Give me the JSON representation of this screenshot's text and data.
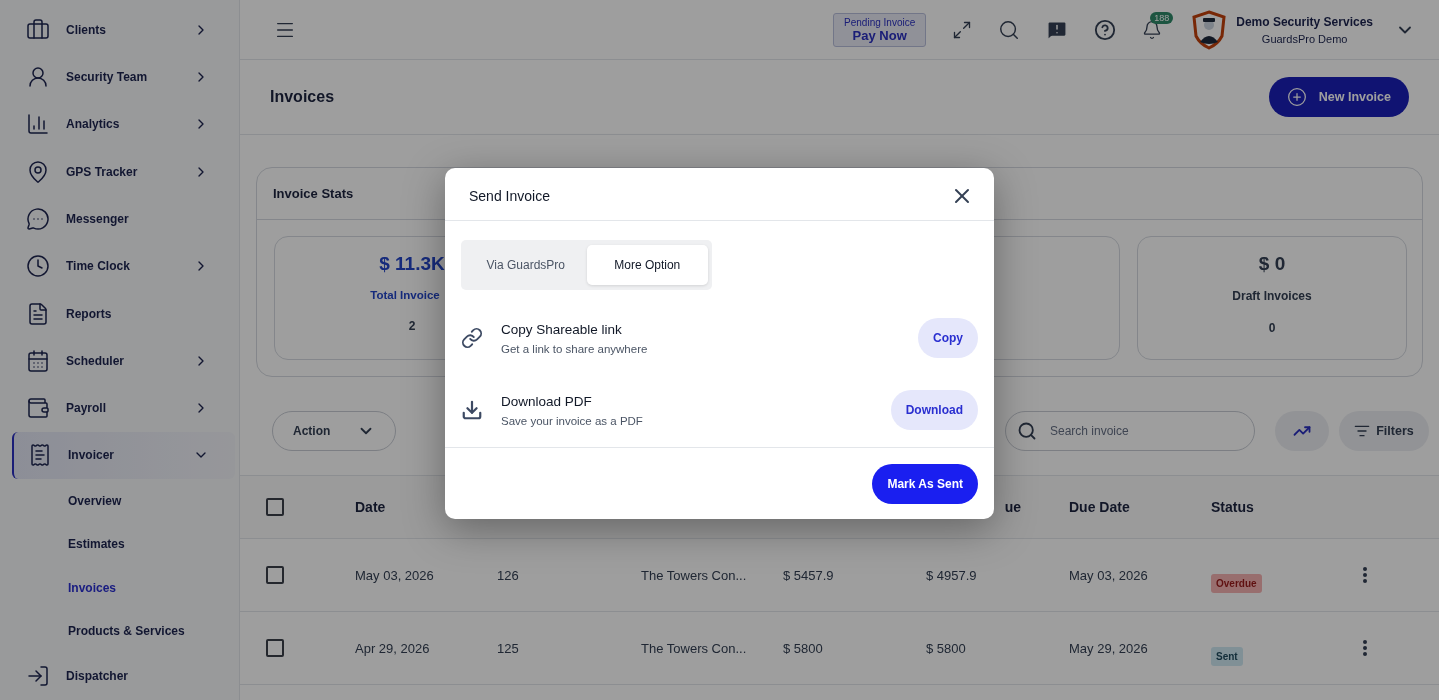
{
  "header": {
    "pending": {
      "label": "Pending Invoice",
      "action": "Pay Now"
    },
    "notification_count": "188",
    "account": {
      "name": "Demo Security Services",
      "subtitle": "GuardsPro Demo"
    }
  },
  "sidebar": {
    "items": [
      {
        "label": "Clients",
        "expandable": true,
        "expanded": false,
        "selected": false
      },
      {
        "label": "Security Team",
        "expandable": true,
        "expanded": false,
        "selected": false
      },
      {
        "label": "Analytics",
        "expandable": true,
        "expanded": false,
        "selected": false
      },
      {
        "label": "GPS Tracker",
        "expandable": true,
        "expanded": false,
        "selected": false
      },
      {
        "label": "Messenger",
        "expandable": false,
        "expanded": false,
        "selected": false
      },
      {
        "label": "Time Clock",
        "expandable": true,
        "expanded": false,
        "selected": false
      },
      {
        "label": "Reports",
        "expandable": false,
        "expanded": false,
        "selected": false
      },
      {
        "label": "Scheduler",
        "expandable": true,
        "expanded": false,
        "selected": false
      },
      {
        "label": "Payroll",
        "expandable": true,
        "expanded": false,
        "selected": false
      },
      {
        "label": "Invoicer",
        "expandable": true,
        "expanded": true,
        "selected": true,
        "children": [
          {
            "label": "Overview",
            "selected": false
          },
          {
            "label": "Estimates",
            "selected": false
          },
          {
            "label": "Invoices",
            "selected": true
          },
          {
            "label": "Products & Services",
            "selected": false
          }
        ]
      },
      {
        "label": "Dispatcher",
        "expandable": false,
        "expanded": false,
        "selected": false
      }
    ]
  },
  "page": {
    "title": "Invoices",
    "new_button": "New Invoice"
  },
  "stats": {
    "title": "Invoice Stats",
    "cards": [
      {
        "kind": "total",
        "value": "$ 11.3K",
        "label": "Total Invoice",
        "count": "2"
      },
      {
        "kind": "hidden"
      },
      {
        "kind": "covered"
      },
      {
        "kind": "draft",
        "value": "$ 0",
        "label": "Draft Invoices",
        "count": "0"
      }
    ]
  },
  "toolbar": {
    "action": "Action",
    "search": {
      "placeholder": "Search invoice"
    },
    "filters": "Filters"
  },
  "table": {
    "all_checked": false,
    "columns": [
      {
        "label": "Date"
      },
      {},
      {},
      {},
      {
        "label": "ue",
        "kind": "clipped"
      },
      {
        "label": "Due Date"
      },
      {
        "label": "Status"
      }
    ],
    "rows": [
      {
        "checked": false,
        "cells": [
          "May 03, 2026",
          "126",
          "The Towers Con...",
          "$ 5457.9",
          "$ 4957.9",
          "May 03, 2026"
        ],
        "status": {
          "label": "Overdue",
          "kind": "overdue"
        }
      },
      {
        "checked": false,
        "cells": [
          "Apr 29, 2026",
          "125",
          "The Towers Con...",
          "$ 5800",
          "$ 5800",
          "May 29, 2026"
        ],
        "status": {
          "label": "Sent",
          "kind": "sent"
        }
      }
    ]
  },
  "modal": {
    "title": "Send Invoice",
    "tabs": [
      {
        "label": "Via GuardsPro",
        "selected": false
      },
      {
        "label": "More Option",
        "selected": true
      }
    ],
    "options": [
      {
        "kind": "link",
        "title": "Copy Shareable link",
        "description": "Get a link to share anywhere",
        "action": "Copy"
      },
      {
        "kind": "download",
        "title": "Download PDF",
        "description": "Save your invoice as a PDF",
        "action": "Download"
      }
    ],
    "primary": "Mark As Sent"
  }
}
